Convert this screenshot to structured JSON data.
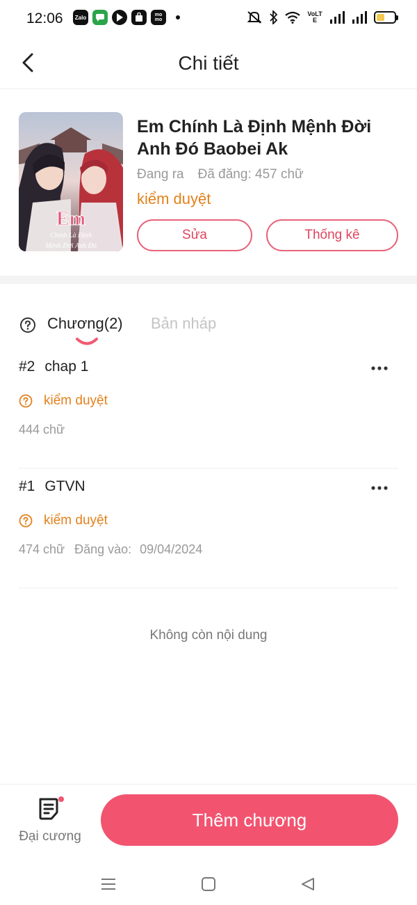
{
  "status_bar": {
    "time": "12:06",
    "app_icons": [
      "Zalo",
      "messages-icon",
      "play-icon",
      "shop-icon",
      "momo-icon"
    ],
    "zalo_label": "Zalo",
    "momo_label": "mo mo",
    "volte_label": "VoLTE",
    "battery_level": 0.45
  },
  "header": {
    "title": "Chi tiết"
  },
  "book": {
    "title": "Em Chính Là Định Mệnh Đời Anh Đó Baobei Ak",
    "status": "Đang ra",
    "word_count": "Đã đăng: 457 chữ",
    "review_status": "kiểm duyệt",
    "edit_label": "Sửa",
    "stats_label": "Thống kê",
    "cover_text_main": "Em",
    "cover_text_sub1": "Chính Là Định",
    "cover_text_sub2": "Mệnh Đời Anh Đó"
  },
  "tabs": {
    "chapters": "Chương(2)",
    "drafts": "Bản nháp"
  },
  "chapters": [
    {
      "number": "#2",
      "title": "chap 1",
      "status": "kiểm duyệt",
      "words": "444 chữ",
      "posted_label": "",
      "posted_date": ""
    },
    {
      "number": "#1",
      "title": "GTVN",
      "status": "kiểm duyệt",
      "words": "474 chữ",
      "posted_label": "Đăng vào:",
      "posted_date": "09/04/2024"
    }
  ],
  "end_message": "Không còn nội dung",
  "bottom_bar": {
    "outline_label": "Đại cương",
    "add_chapter_label": "Thêm chương"
  },
  "colors": {
    "accent": "#f25470",
    "review": "#e3811c",
    "muted": "#999999"
  }
}
